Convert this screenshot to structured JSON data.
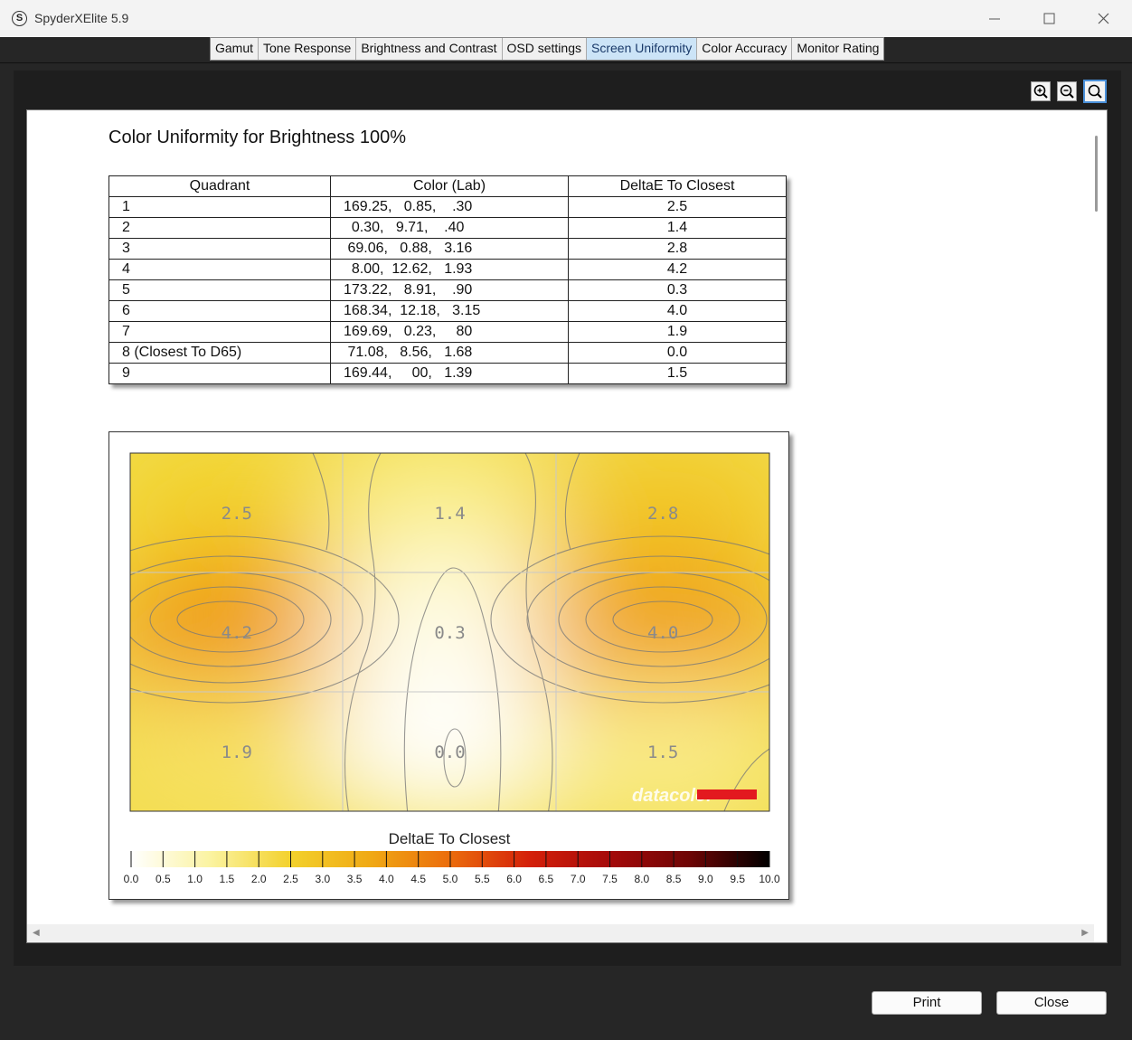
{
  "window": {
    "title": "SpyderXElite 5.9",
    "app_icon_letter": "S"
  },
  "tabs": [
    "Gamut",
    "Tone Response",
    "Brightness and Contrast",
    "OSD settings",
    "Screen Uniformity",
    "Color Accuracy",
    "Monitor Rating"
  ],
  "active_tab": "Screen Uniformity",
  "zoom_tools": [
    "zoom-in-icon",
    "zoom-out-icon",
    "zoom-fit-icon"
  ],
  "report": {
    "title": "Color Uniformity for Brightness 100%",
    "table": {
      "headers": [
        "Quadrant",
        "Color (Lab)",
        "DeltaE To Closest"
      ],
      "rows": [
        [
          "1",
          "169.25,   0.85,    .30",
          "2.5"
        ],
        [
          "2",
          "  0.30,   9.71,    .40",
          "1.4"
        ],
        [
          "3",
          " 69.06,   0.88,   3.16",
          "2.8"
        ],
        [
          "4",
          "  8.00,  12.62,   1.93",
          "4.2"
        ],
        [
          "5",
          "173.22,   8.91,    .90",
          "0.3"
        ],
        [
          "6",
          "168.34,  12.18,   3.15",
          "4.0"
        ],
        [
          "7",
          "169.69,   0.23,     80",
          "1.9"
        ],
        [
          "8 (Closest To D65)",
          " 71.08,   8.56,   1.68",
          "0.0"
        ],
        [
          "9",
          "169.44,     00,   1.39",
          "1.5"
        ]
      ]
    }
  },
  "chart_data": {
    "type": "heatmap",
    "grid": [
      3,
      3
    ],
    "values": [
      [
        2.5,
        1.4,
        2.8
      ],
      [
        4.2,
        0.3,
        4.0
      ],
      [
        1.9,
        0.0,
        1.5
      ]
    ],
    "value_labels": [
      [
        "2.5",
        "1.4",
        "2.8"
      ],
      [
        "4.2",
        "0.3",
        "4.0"
      ],
      [
        "1.9",
        "0.0",
        "1.5"
      ]
    ],
    "colorbar_title": "DeltaE To Closest",
    "colorbar_range": [
      0,
      10
    ],
    "colorbar_ticks": [
      "0.0",
      "0.5",
      "1.0",
      "1.5",
      "2.0",
      "2.5",
      "3.0",
      "3.5",
      "4.0",
      "4.5",
      "5.0",
      "5.5",
      "6.0",
      "6.5",
      "7.0",
      "7.5",
      "8.0",
      "8.5",
      "9.0",
      "9.5",
      "10.0"
    ],
    "colorscale": [
      "#ffffff",
      "#fbf3a0",
      "#f3d12c",
      "#f0a914",
      "#eb6c0c",
      "#d4200a",
      "#a50a0a",
      "#6e0505",
      "#000000"
    ],
    "watermark": "datacolor",
    "watermark_color": "#e3191f"
  },
  "buttons": {
    "print": "Print",
    "close": "Close"
  },
  "colors": {
    "active_tab_bg": "#cce4f7",
    "window_bg": "#262626"
  }
}
